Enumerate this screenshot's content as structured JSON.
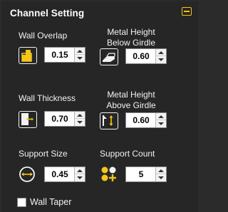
{
  "panel": {
    "title": "Channel Setting"
  },
  "fields": {
    "wall_overlap": {
      "label": "Wall Overlap",
      "value": "0.15",
      "icon": "wall-overlap-icon"
    },
    "metal_height_below_girdle": {
      "label_line1": "Metal  Height",
      "label_line2": "Below Girdle",
      "value": "0.60",
      "icon": "metal-height-below-girdle-icon"
    },
    "wall_thickness": {
      "label": "Wall Thickness",
      "value": "0.70",
      "icon": "wall-thickness-icon"
    },
    "metal_height_above_girdle": {
      "label_line1": "Metal  Height",
      "label_line2": "Above  Girdle",
      "value": "0.60",
      "icon": "metal-height-above-girdle-icon"
    },
    "support_size": {
      "label": "Support Size",
      "value": "0.45",
      "icon": "support-size-icon"
    },
    "support_count": {
      "label": "Support Count",
      "value": "5",
      "icon": "support-count-icon"
    }
  },
  "wall_taper": {
    "label": "Wall Taper",
    "checked": false
  },
  "colors": {
    "accent": "#f5c518",
    "background": "#262626",
    "text": "#ffffff"
  }
}
